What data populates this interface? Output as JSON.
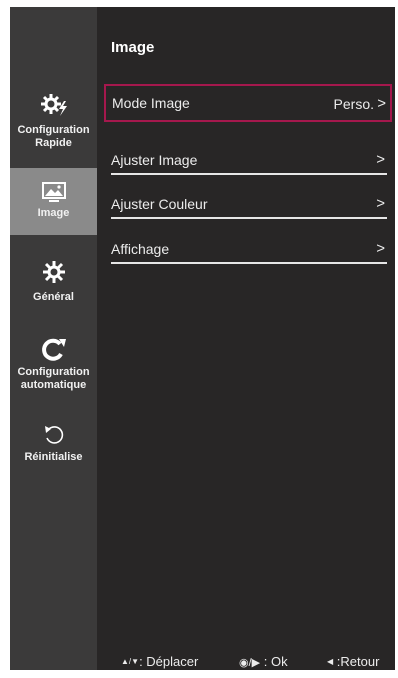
{
  "sidebar": {
    "items": [
      {
        "label": "Configuration\nRapide",
        "icon": "gear-bolt-icon"
      },
      {
        "label": "Image",
        "icon": "picture-icon",
        "selected": true
      },
      {
        "label": "Général",
        "icon": "gear-icon"
      },
      {
        "label": "Configuration\nautomatique",
        "icon": "auto-config-icon"
      },
      {
        "label": "Réinitialise",
        "icon": "reset-icon"
      }
    ]
  },
  "menu": {
    "title": "Image",
    "rows": [
      {
        "label": "Mode Image",
        "value": "Perso."
      },
      {
        "label": "Ajuster Image"
      },
      {
        "label": "Ajuster Couleur"
      },
      {
        "label": "Affichage"
      }
    ]
  },
  "footer": {
    "move_label": ": Déplacer",
    "ok_label": ": Ok",
    "back_label": ":Retour"
  },
  "colors": {
    "highlight_border": "#a5184d",
    "sidebar_bg": "#3b3a3a",
    "selected_bg": "#8a8a8a",
    "panel_bg": "#282626"
  }
}
